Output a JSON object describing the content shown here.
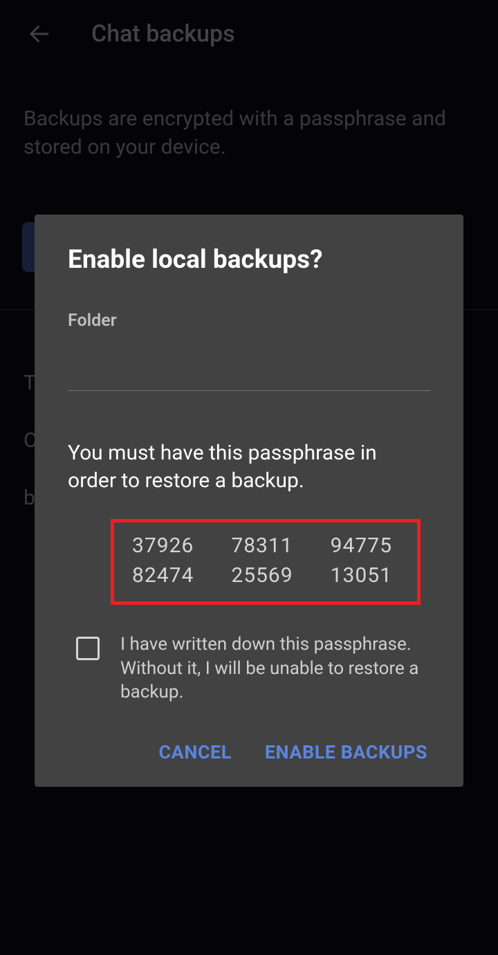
{
  "header": {
    "title": "Chat backups"
  },
  "page": {
    "description": "Backups are encrypted with a passphrase and stored on your device.",
    "secondary_text_lines": [
      "T",
      "O",
      "b"
    ]
  },
  "modal": {
    "title": "Enable local backups?",
    "folder_label": "Folder",
    "folder_value": "",
    "passphrase_message": "You must have this passphrase in order to restore a backup.",
    "passphrase_groups": [
      "37926",
      "78311",
      "94775",
      "82474",
      "25569",
      "13051"
    ],
    "confirm_text": "I have written down this passphrase. Without it, I will be unable to restore a backup.",
    "confirm_checked": false,
    "actions": {
      "cancel": "CANCEL",
      "enable": "ENABLE BACKUPS"
    }
  },
  "colors": {
    "accent": "#5b85e0",
    "highlight_border": "#ef1f1f"
  }
}
